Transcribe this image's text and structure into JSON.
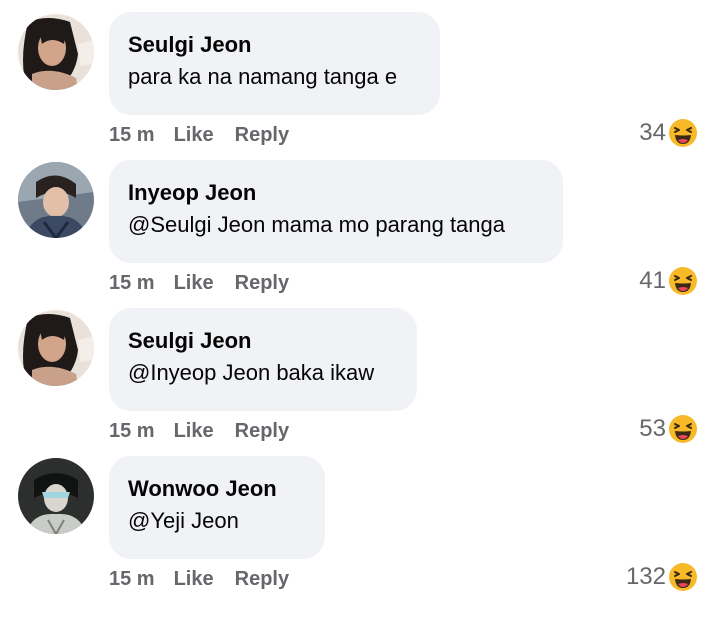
{
  "comments": [
    {
      "name": "Seulgi Jeon",
      "text": "para ka na namang tanga e",
      "time": "15 m",
      "like_label": "Like",
      "reply_label": "Reply",
      "reaction_count": "34",
      "reaction_icon": "haha-emoji-icon"
    },
    {
      "name": "Inyeop Jeon",
      "text": "@Seulgi Jeon mama mo parang tanga",
      "time": "15 m",
      "like_label": "Like",
      "reply_label": "Reply",
      "reaction_count": "41",
      "reaction_icon": "haha-emoji-icon"
    },
    {
      "name": "Seulgi Jeon",
      "text": "@Inyeop Jeon baka ikaw",
      "time": "15 m",
      "like_label": "Like",
      "reply_label": "Reply",
      "reaction_count": "53",
      "reaction_icon": "haha-emoji-icon"
    },
    {
      "name": "Wonwoo Jeon",
      "text": "@Yeji Jeon",
      "time": "15 m",
      "like_label": "Like",
      "reply_label": "Reply",
      "reaction_count": "132",
      "reaction_icon": "haha-emoji-icon"
    }
  ],
  "colors": {
    "bubble": "#f0f2f5",
    "secondary_text": "#65676b",
    "primary_text": "#050505",
    "haha_yellow": "#f7b928"
  }
}
